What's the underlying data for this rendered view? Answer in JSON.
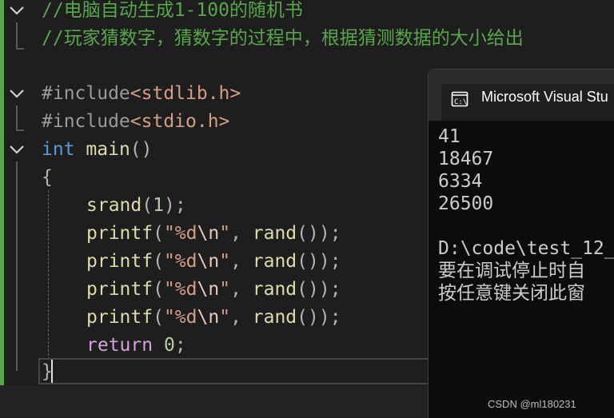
{
  "editor": {
    "lines": {
      "comment1": "//电脑自动生成1-100的随机书",
      "comment2": "//玩家猜数字，猜数字的过程中，根据猜测数据的大小给出",
      "include1_directive": "#include",
      "include1_file": "<stdlib.h>",
      "include2_directive": "#include",
      "include2_file": "<stdio.h>",
      "main_type": "int",
      "main_name": "main",
      "main_parens": "()",
      "open_brace": "{",
      "srand_call": "srand",
      "srand_open": "(",
      "srand_arg": "1",
      "srand_close": ");",
      "printf_name": "printf",
      "printf_open": "(",
      "printf_fmt_start": "\"%d",
      "printf_fmt_escape": "\\n",
      "printf_fmt_end": "\"",
      "printf_comma": ", ",
      "rand_name": "rand",
      "printf_close": "());",
      "return_kw": "return",
      "return_val": "0",
      "semicolon": ";",
      "close_brace": "}"
    }
  },
  "console": {
    "title": "Microsoft Visual Stu",
    "output": [
      "41",
      "18467",
      "6334",
      "26500",
      "",
      "D:\\code\\test_12_",
      "要在调试停止时自",
      "按任意键关闭此窗"
    ]
  },
  "watermark": "CSDN @ml180231",
  "icons": {
    "fold": "chevron-down-icon",
    "console": "console-icon"
  },
  "colors": {
    "background": "#1e1e1e",
    "comment": "#57a64a",
    "keyword": "#569cd6",
    "function": "#dcdcaa",
    "string": "#d69d85",
    "control": "#d8a0df",
    "console_bg": "#0c0c0c"
  }
}
